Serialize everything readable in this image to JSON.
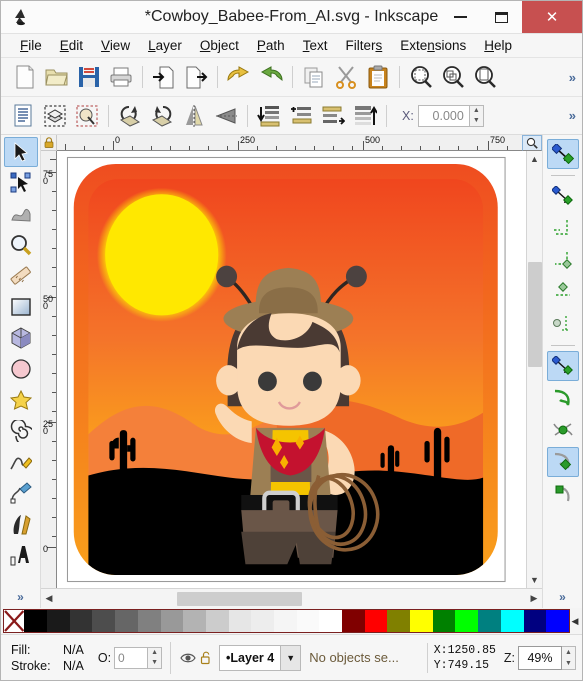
{
  "window": {
    "title": "*Cowboy_Babee-From_AI.svg - Inkscape",
    "logo_icon": "inkscape-logo-icon",
    "minimize_label": "minimize-icon",
    "maximize_label": "maximize-icon",
    "close_label": "✕",
    "close_color": "#c75050"
  },
  "menu": [
    {
      "label": "File",
      "mnemonic": "F"
    },
    {
      "label": "Edit",
      "mnemonic": "E"
    },
    {
      "label": "View",
      "mnemonic": "V"
    },
    {
      "label": "Layer",
      "mnemonic": "L"
    },
    {
      "label": "Object",
      "mnemonic": "O"
    },
    {
      "label": "Path",
      "mnemonic": "P"
    },
    {
      "label": "Text",
      "mnemonic": "T"
    },
    {
      "label": "Filters",
      "mnemonic": "s"
    },
    {
      "label": "Extensions",
      "mnemonic": "n"
    },
    {
      "label": "Help",
      "mnemonic": "H"
    }
  ],
  "command_toolbar": {
    "more_label": "»",
    "items": [
      {
        "name": "new-document-icon",
        "title": "New"
      },
      {
        "name": "open-document-icon",
        "title": "Open"
      },
      {
        "name": "save-document-icon",
        "title": "Save"
      },
      {
        "name": "print-icon",
        "title": "Print"
      },
      {
        "name": "import-icon",
        "title": "Import"
      },
      {
        "name": "export-icon",
        "title": "Export"
      },
      {
        "name": "undo-icon",
        "title": "Undo"
      },
      {
        "name": "redo-icon",
        "title": "Redo"
      },
      {
        "name": "copy-icon",
        "title": "Copy"
      },
      {
        "name": "cut-icon",
        "title": "Cut"
      },
      {
        "name": "paste-icon",
        "title": "Paste"
      },
      {
        "name": "zoom-selection-icon",
        "title": "Zoom selection"
      },
      {
        "name": "zoom-drawing-icon",
        "title": "Zoom drawing"
      },
      {
        "name": "zoom-page-icon",
        "title": "Zoom page"
      }
    ]
  },
  "tool_controls_bar": {
    "x_label": "X:",
    "x_value": "0.000",
    "more_label": "»",
    "items": [
      {
        "name": "select-all-icon",
        "title": "Select All"
      },
      {
        "name": "select-all-layers-icon",
        "title": "Select All in All Layers"
      },
      {
        "name": "deselect-icon",
        "title": "Deselect"
      },
      {
        "name": "rotate-ccw-icon",
        "title": "Rotate 90 CCW"
      },
      {
        "name": "rotate-cw-icon",
        "title": "Rotate 90 CW"
      },
      {
        "name": "flip-horizontal-icon",
        "title": "Flip Horizontal"
      },
      {
        "name": "flip-vertical-icon",
        "title": "Flip Vertical"
      },
      {
        "name": "lower-to-bottom-icon",
        "title": "Lower to Bottom"
      },
      {
        "name": "lower-icon",
        "title": "Lower"
      },
      {
        "name": "raise-icon",
        "title": "Raise"
      },
      {
        "name": "raise-to-top-icon",
        "title": "Raise to Top"
      }
    ]
  },
  "toolbox": {
    "more_label": "»",
    "tools": [
      {
        "name": "selector-tool",
        "icon": "arrow-cursor-icon",
        "active": true
      },
      {
        "name": "node-tool",
        "icon": "node-editor-icon",
        "active": false
      },
      {
        "name": "tweak-tool",
        "icon": "tweak-icon",
        "active": false
      },
      {
        "name": "zoom-tool",
        "icon": "magnifier-icon",
        "active": false
      },
      {
        "name": "measure-tool",
        "icon": "ruler-icon",
        "active": false
      },
      {
        "name": "rectangle-tool",
        "icon": "rectangle-icon",
        "active": false
      },
      {
        "name": "box3d-tool",
        "icon": "cube-icon",
        "active": false
      },
      {
        "name": "ellipse-tool",
        "icon": "circle-icon",
        "active": false
      },
      {
        "name": "star-tool",
        "icon": "star-icon",
        "active": false
      },
      {
        "name": "spiral-tool",
        "icon": "spiral-icon",
        "active": false
      },
      {
        "name": "pencil-tool",
        "icon": "pencil-icon",
        "active": false
      },
      {
        "name": "bezier-tool",
        "icon": "pen-icon",
        "active": false
      },
      {
        "name": "calligraphy-tool",
        "icon": "calligraphy-pen-icon",
        "active": false
      },
      {
        "name": "text-tool",
        "icon": "text-a-icon",
        "active": false
      }
    ]
  },
  "snapbar": {
    "more_label": "»",
    "items": [
      {
        "name": "enable-snapping",
        "icon": "snap-master-icon",
        "active": true,
        "divider_after": true
      },
      {
        "name": "snap-bounding-box",
        "icon": "snap-bbox-icon",
        "active": false
      },
      {
        "name": "snap-bbox-corner",
        "icon": "snap-bbox-corner-icon",
        "active": false
      },
      {
        "name": "snap-bbox-edge",
        "icon": "snap-bbox-edge-icon",
        "active": false
      },
      {
        "name": "snap-bbox-edge-midpoint",
        "icon": "snap-bbox-edge-mid-icon",
        "active": false
      },
      {
        "name": "snap-bbox-center",
        "icon": "snap-bbox-center-icon",
        "active": false,
        "divider_after": true
      },
      {
        "name": "snap-nodes-paths",
        "icon": "snap-nodes-icon",
        "active": true
      },
      {
        "name": "snap-path",
        "icon": "snap-path-icon",
        "active": false
      },
      {
        "name": "snap-path-intersection",
        "icon": "snap-path-intersect-icon",
        "active": false
      },
      {
        "name": "snap-cusp-node",
        "icon": "snap-cusp-node-icon",
        "active": true
      },
      {
        "name": "snap-smooth-node",
        "icon": "snap-smooth-node-icon",
        "active": false
      }
    ]
  },
  "rulers": {
    "horizontal_labels": [
      "0",
      "250",
      "500",
      "750"
    ],
    "vertical_labels": [
      "750",
      "500",
      "250",
      "0"
    ],
    "lock_icon": "lock-icon",
    "zoom_icon": "magnifier-icon"
  },
  "canvas": {
    "artwork_title": "Cowboy Babee desert scene",
    "scroll_left_icon": "chevron-left-icon",
    "scroll_right_icon": "chevron-right-icon",
    "scroll_up_icon": "chevron-up-icon",
    "scroll_down_icon": "chevron-down-icon",
    "colors": {
      "sky_top": "#f05a28",
      "sky_bottom": "#ffd400",
      "sun": "#ffe600",
      "dune_far": "#f07030",
      "dune_near": "#ef6a28",
      "ground": "#000000",
      "frame": "#f58220",
      "hat": "#9a7b52",
      "hat_brim": "#a98a5f",
      "hair": "#4a3a33",
      "skin": "#fbd9b4",
      "bandana": "#c4122f",
      "star": "#f9b000",
      "shirt": "#f5c400",
      "vest": "#9a7b52",
      "belt": "#111111",
      "buckle": "#cfcfcf",
      "pants": "#5a4a42",
      "rope": "#8b5e35",
      "eye": "#3a3a3a"
    }
  },
  "palette": {
    "none_label": "X",
    "swatches": [
      "#000000",
      "#1a1a1a",
      "#333333",
      "#4d4d4d",
      "#666666",
      "#808080",
      "#999999",
      "#b3b3b3",
      "#cccccc",
      "#e6e6e6",
      "#ededed",
      "#f5f5f5",
      "#fafafa",
      "#ffffff",
      "#800000",
      "#ff0000",
      "#808000",
      "#ffff00",
      "#008000",
      "#00ff00",
      "#008080",
      "#00ffff",
      "#000080",
      "#0000ff"
    ],
    "arrow_label": "◀"
  },
  "statusbar": {
    "fill_label": "Fill:",
    "fill_value": "N/A",
    "stroke_label": "Stroke:",
    "stroke_value": "N/A",
    "opacity_label": "O:",
    "opacity_value": "0",
    "eye_icon": "eye-icon",
    "lock_icon": "unlock-icon",
    "layer_name": "•Layer 4",
    "layer_arrow": "⌄",
    "selection_status": "No objects se...",
    "x_label": "X:",
    "x_value": "1250.85",
    "y_label": "Y:",
    "y_value": "749.15",
    "zoom_label": "Z:",
    "zoom_value": "49%",
    "resize_grip_icon": "resize-grip-icon"
  }
}
